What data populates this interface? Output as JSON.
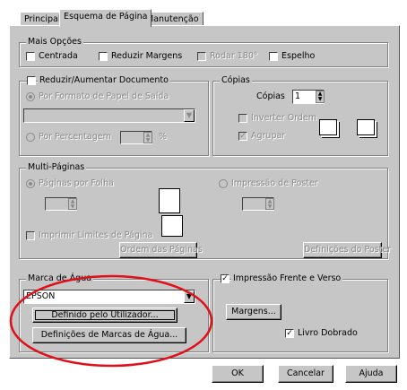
{
  "tabs": [
    "Principal",
    "Esquema de Página",
    "Manutenção"
  ],
  "mais_opcoes": {
    "title": "Mais Opções",
    "centrada": "Centrada",
    "reduzir_margens": "Reduzir Margens",
    "rodar": "Rodar 180°",
    "espelho": "Espelho"
  },
  "reduzir": {
    "title": "Reduzir/Aumentar Documento",
    "por_formato": "Por Formato de Papel de Saída",
    "por_percentagem": "Por Percentagem",
    "percent_symbol": "%"
  },
  "copias": {
    "title": "Cópias",
    "label": "Cópias",
    "value": "1",
    "inverter": "Inverter Ordem",
    "agrupar": "Agrupar"
  },
  "multi": {
    "title": "Multi-Páginas",
    "paginas_por_folha": "Páginas por Folha",
    "impressao_poster": "Impressão de Poster",
    "imprimir_limites": "Imprimir Limites de Página",
    "ordem_paginas": "Ordem das Páginas",
    "definicoes_poster": "Definições do Poster"
  },
  "marca": {
    "title": "Marca de Água",
    "selected": "EPSON",
    "definido_btn": "Definido pelo Utilizador...",
    "definicoes_btn": "Definições de Marcas de Água..."
  },
  "frente_verso": {
    "title": "Impressão Frente e Verso",
    "margens_btn": "Margens...",
    "livro": "Livro Dobrado"
  },
  "footer": {
    "ok": "OK",
    "cancel": "Cancelar",
    "help": "Ajuda"
  },
  "colors": {
    "panel": "#c6c6c6",
    "highlight": "#e0101a"
  }
}
